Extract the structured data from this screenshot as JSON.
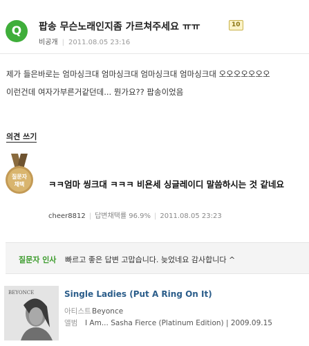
{
  "question": {
    "badge": "Q",
    "title": "팝송 무슨노래인지좀 가르쳐주세요 ㅠㅠ",
    "points": "10",
    "author": "비공개",
    "date": "2011.08.05 23:16",
    "body_lines": [
      "제가 들은바로는 엄마싱크대 엄마싱크대 엄마싱크대 엄마싱크대 오오오오오오오",
      "이런건데 여자가부른거같던데... 뭔가요?? 팝송이었음"
    ]
  },
  "opinion_link": "의견 쓰기",
  "answer": {
    "medal_text": [
      "질문자",
      "채택"
    ],
    "text": "ㅋㅋ엄마 씽크대 ㅋㅋㅋ 비욘세 싱글레이디 말씀하시는 것 같네요",
    "author": "cheer8812",
    "adopt_rate_label": "답변채택률",
    "adopt_rate": "96.9%",
    "date": "2011.08.05 23:23"
  },
  "thanks": {
    "label": "질문자 인사",
    "text": "빠르고 좋은 답변 고맙습니다. 늦었네요 감사합니다 ^"
  },
  "song": {
    "title": "Single Ladies (Put A Ring On It)",
    "artist_label": "아티스트",
    "artist": "Beyonce",
    "album_label": "앨범",
    "album": "I Am... Sasha Fierce (Platinum Edition) | 2009.09.15",
    "cover_text": "BEYONCE"
  }
}
